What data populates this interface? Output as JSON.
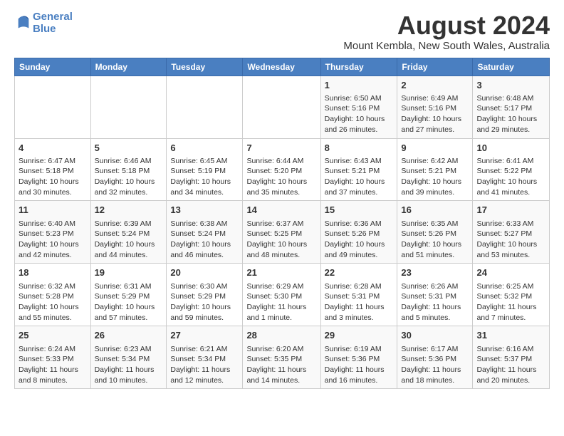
{
  "header": {
    "logo_line1": "General",
    "logo_line2": "Blue",
    "title": "August 2024",
    "subtitle": "Mount Kembla, New South Wales, Australia"
  },
  "days_of_week": [
    "Sunday",
    "Monday",
    "Tuesday",
    "Wednesday",
    "Thursday",
    "Friday",
    "Saturday"
  ],
  "weeks": [
    [
      {
        "day": "",
        "content": ""
      },
      {
        "day": "",
        "content": ""
      },
      {
        "day": "",
        "content": ""
      },
      {
        "day": "",
        "content": ""
      },
      {
        "day": "1",
        "content": "Sunrise: 6:50 AM\nSunset: 5:16 PM\nDaylight: 10 hours\nand 26 minutes."
      },
      {
        "day": "2",
        "content": "Sunrise: 6:49 AM\nSunset: 5:16 PM\nDaylight: 10 hours\nand 27 minutes."
      },
      {
        "day": "3",
        "content": "Sunrise: 6:48 AM\nSunset: 5:17 PM\nDaylight: 10 hours\nand 29 minutes."
      }
    ],
    [
      {
        "day": "4",
        "content": "Sunrise: 6:47 AM\nSunset: 5:18 PM\nDaylight: 10 hours\nand 30 minutes."
      },
      {
        "day": "5",
        "content": "Sunrise: 6:46 AM\nSunset: 5:18 PM\nDaylight: 10 hours\nand 32 minutes."
      },
      {
        "day": "6",
        "content": "Sunrise: 6:45 AM\nSunset: 5:19 PM\nDaylight: 10 hours\nand 34 minutes."
      },
      {
        "day": "7",
        "content": "Sunrise: 6:44 AM\nSunset: 5:20 PM\nDaylight: 10 hours\nand 35 minutes."
      },
      {
        "day": "8",
        "content": "Sunrise: 6:43 AM\nSunset: 5:21 PM\nDaylight: 10 hours\nand 37 minutes."
      },
      {
        "day": "9",
        "content": "Sunrise: 6:42 AM\nSunset: 5:21 PM\nDaylight: 10 hours\nand 39 minutes."
      },
      {
        "day": "10",
        "content": "Sunrise: 6:41 AM\nSunset: 5:22 PM\nDaylight: 10 hours\nand 41 minutes."
      }
    ],
    [
      {
        "day": "11",
        "content": "Sunrise: 6:40 AM\nSunset: 5:23 PM\nDaylight: 10 hours\nand 42 minutes."
      },
      {
        "day": "12",
        "content": "Sunrise: 6:39 AM\nSunset: 5:24 PM\nDaylight: 10 hours\nand 44 minutes."
      },
      {
        "day": "13",
        "content": "Sunrise: 6:38 AM\nSunset: 5:24 PM\nDaylight: 10 hours\nand 46 minutes."
      },
      {
        "day": "14",
        "content": "Sunrise: 6:37 AM\nSunset: 5:25 PM\nDaylight: 10 hours\nand 48 minutes."
      },
      {
        "day": "15",
        "content": "Sunrise: 6:36 AM\nSunset: 5:26 PM\nDaylight: 10 hours\nand 49 minutes."
      },
      {
        "day": "16",
        "content": "Sunrise: 6:35 AM\nSunset: 5:26 PM\nDaylight: 10 hours\nand 51 minutes."
      },
      {
        "day": "17",
        "content": "Sunrise: 6:33 AM\nSunset: 5:27 PM\nDaylight: 10 hours\nand 53 minutes."
      }
    ],
    [
      {
        "day": "18",
        "content": "Sunrise: 6:32 AM\nSunset: 5:28 PM\nDaylight: 10 hours\nand 55 minutes."
      },
      {
        "day": "19",
        "content": "Sunrise: 6:31 AM\nSunset: 5:29 PM\nDaylight: 10 hours\nand 57 minutes."
      },
      {
        "day": "20",
        "content": "Sunrise: 6:30 AM\nSunset: 5:29 PM\nDaylight: 10 hours\nand 59 minutes."
      },
      {
        "day": "21",
        "content": "Sunrise: 6:29 AM\nSunset: 5:30 PM\nDaylight: 11 hours\nand 1 minute."
      },
      {
        "day": "22",
        "content": "Sunrise: 6:28 AM\nSunset: 5:31 PM\nDaylight: 11 hours\nand 3 minutes."
      },
      {
        "day": "23",
        "content": "Sunrise: 6:26 AM\nSunset: 5:31 PM\nDaylight: 11 hours\nand 5 minutes."
      },
      {
        "day": "24",
        "content": "Sunrise: 6:25 AM\nSunset: 5:32 PM\nDaylight: 11 hours\nand 7 minutes."
      }
    ],
    [
      {
        "day": "25",
        "content": "Sunrise: 6:24 AM\nSunset: 5:33 PM\nDaylight: 11 hours\nand 8 minutes."
      },
      {
        "day": "26",
        "content": "Sunrise: 6:23 AM\nSunset: 5:34 PM\nDaylight: 11 hours\nand 10 minutes."
      },
      {
        "day": "27",
        "content": "Sunrise: 6:21 AM\nSunset: 5:34 PM\nDaylight: 11 hours\nand 12 minutes."
      },
      {
        "day": "28",
        "content": "Sunrise: 6:20 AM\nSunset: 5:35 PM\nDaylight: 11 hours\nand 14 minutes."
      },
      {
        "day": "29",
        "content": "Sunrise: 6:19 AM\nSunset: 5:36 PM\nDaylight: 11 hours\nand 16 minutes."
      },
      {
        "day": "30",
        "content": "Sunrise: 6:17 AM\nSunset: 5:36 PM\nDaylight: 11 hours\nand 18 minutes."
      },
      {
        "day": "31",
        "content": "Sunrise: 6:16 AM\nSunset: 5:37 PM\nDaylight: 11 hours\nand 20 minutes."
      }
    ]
  ]
}
